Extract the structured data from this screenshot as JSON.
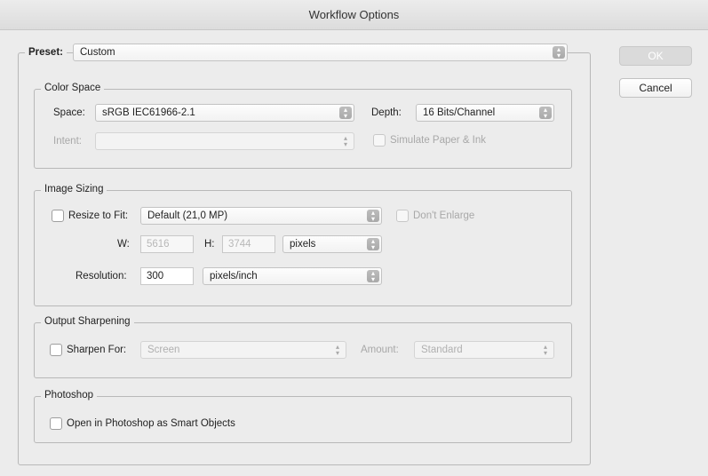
{
  "window": {
    "title": "Workflow Options"
  },
  "preset": {
    "label": "Preset:",
    "value": "Custom"
  },
  "buttons": {
    "ok": "OK",
    "cancel": "Cancel"
  },
  "color_space": {
    "title": "Color Space",
    "space_label": "Space:",
    "space_value": "sRGB IEC61966-2.1",
    "depth_label": "Depth:",
    "depth_value": "16 Bits/Channel",
    "intent_label": "Intent:",
    "intent_value": "",
    "simulate_label": "Simulate Paper & Ink"
  },
  "image_sizing": {
    "title": "Image Sizing",
    "resize_label": "Resize to Fit:",
    "resize_value": "Default  (21,0 MP)",
    "dont_enlarge_label": "Don't Enlarge",
    "w_label": "W:",
    "w_value": "5616",
    "h_label": "H:",
    "h_value": "3744",
    "units_value": "pixels",
    "resolution_label": "Resolution:",
    "resolution_value": "300",
    "resolution_units": "pixels/inch"
  },
  "output_sharpening": {
    "title": "Output Sharpening",
    "sharpen_label": "Sharpen For:",
    "sharpen_value": "Screen",
    "amount_label": "Amount:",
    "amount_value": "Standard"
  },
  "photoshop": {
    "title": "Photoshop",
    "smart_objects_label": "Open in Photoshop as Smart Objects"
  }
}
